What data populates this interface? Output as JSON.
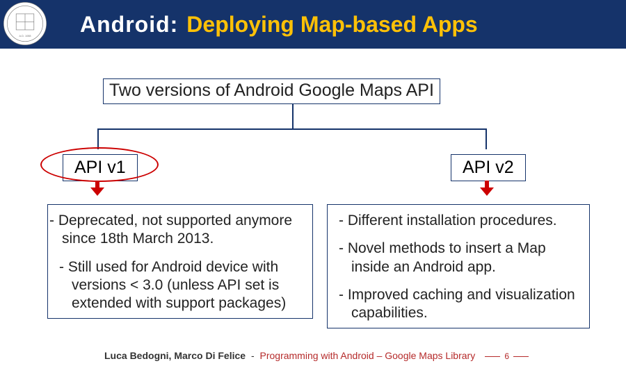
{
  "header": {
    "prefix": "Android:",
    "accent": "Deploying Map-based Apps"
  },
  "intro": "Two versions of Android Google Maps API",
  "nodes": {
    "v1": "API v1",
    "v2": "API v2"
  },
  "panels": {
    "v1": {
      "p1": "-  Deprecated, not supported anymore since 18th March 2013.",
      "p2": "-  Still used for Android device with versions < 3.0 (unless API set is extended with support packages)"
    },
    "v2": {
      "p1": "-  Different installation procedures.",
      "p2": "-  Novel methods to insert a Map inside an Android app.",
      "p3": "-  Improved caching and visualization capabilities."
    }
  },
  "footer": {
    "authors": "Luca Bedogni, Marco Di Felice",
    "course": "Programming with Android – Google Maps Library"
  },
  "page": "6"
}
